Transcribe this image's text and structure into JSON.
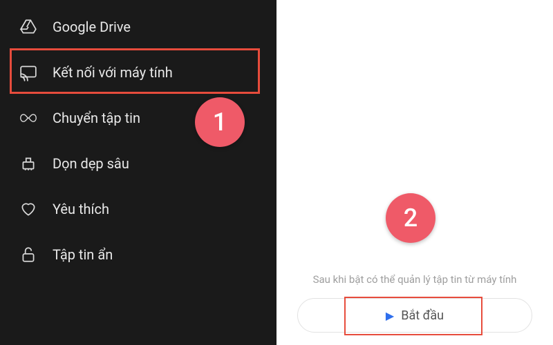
{
  "colors": {
    "accent": "#ef5a68",
    "highlight": "#e74c3c",
    "play": "#2f6fed"
  },
  "annotations": {
    "step1": "1",
    "step2": "2"
  },
  "left_menu": {
    "items": [
      {
        "icon": "google-drive-icon",
        "label": "Google Drive"
      },
      {
        "icon": "cast-icon",
        "label": "Kết nối với máy tính"
      },
      {
        "icon": "infinity-icon",
        "label": "Chuyển tập tin"
      },
      {
        "icon": "broom-icon",
        "label": "Dọn dẹp sâu"
      },
      {
        "icon": "heart-icon",
        "label": "Yêu thích"
      },
      {
        "icon": "lock-icon",
        "label": "Tập tin ẩn"
      }
    ]
  },
  "right_panel": {
    "hint": "Sau khi bật có thể quản lý tập tin từ máy tính",
    "start_label": "Bắt đầu"
  }
}
